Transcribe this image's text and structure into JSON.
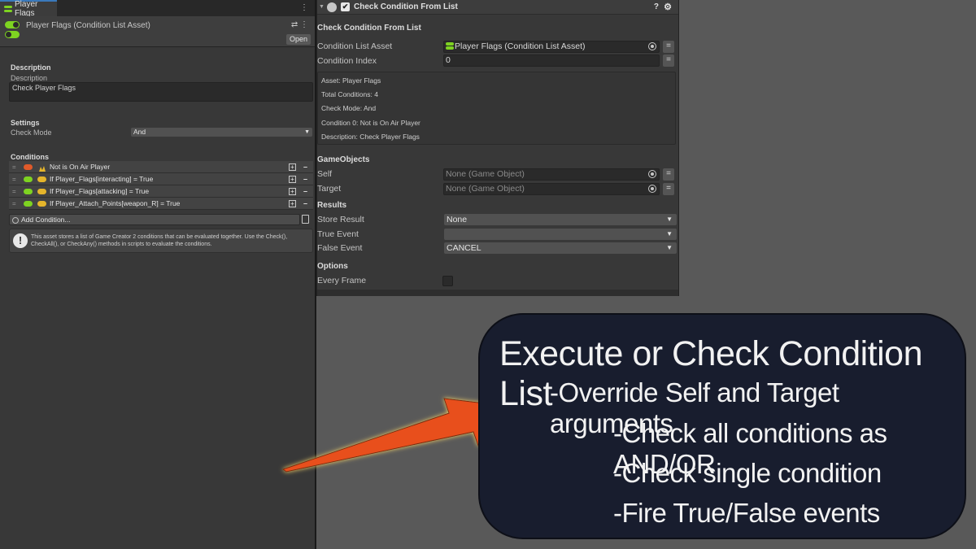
{
  "left_panel": {
    "tab_label": "Player Flags",
    "asset_title": "Player Flags (Condition List Asset)",
    "open_label": "Open",
    "description_header": "Description",
    "description_label": "Description",
    "description_value": "Check Player Flags",
    "settings_header": "Settings",
    "check_mode_label": "Check Mode",
    "check_mode_value": "And",
    "conditions_header": "Conditions",
    "conditions": [
      {
        "text": "Not is On Air Player"
      },
      {
        "text": "If Player_Flags[interacting] = True"
      },
      {
        "text": "If Player_Flags[attacking] = True"
      },
      {
        "text": "If Player_Attach_Points[weapon_R] = True"
      }
    ],
    "add_condition_label": "Add Condition...",
    "info_text": "This asset stores a list of Game Creator 2 conditions that can be evaluated together. Use the Check(), CheckAll(), or CheckAny() methods in scripts to evaluate the conditions."
  },
  "inspector": {
    "component_title": "Check Condition From List",
    "section_title": "Check Condition From List",
    "condition_list_asset_label": "Condition List Asset",
    "condition_list_asset_value": "Player Flags (Condition List Asset)",
    "condition_index_label": "Condition Index",
    "condition_index_value": "0",
    "summary": {
      "asset": "Asset: Player Flags",
      "total": "Total Conditions: 4",
      "mode": "Check Mode: And",
      "condition0": "Condition 0: Not is On Air Player",
      "description": "Description: Check Player Flags"
    },
    "gameobjects_header": "GameObjects",
    "self_label": "Self",
    "self_value": "None (Game Object)",
    "target_label": "Target",
    "target_value": "None (Game Object)",
    "results_header": "Results",
    "store_result_label": "Store Result",
    "store_result_value": "None",
    "true_event_label": "True Event",
    "true_event_value": "",
    "false_event_label": "False Event",
    "false_event_value": "CANCEL",
    "options_header": "Options",
    "every_frame_label": "Every Frame"
  },
  "callout": {
    "title": "Execute or Check Condition List",
    "bullets": [
      "-Override Self and Target arguments",
      "-Check all conditions as AND/OR",
      "-Check single condition",
      "-Fire True/False events"
    ]
  },
  "colors": {
    "arrow": "#e8501f",
    "callout_bg": "#181d2e",
    "toggle_green": "#7ed321",
    "toggle_red": "#e05a2a",
    "icon_yellow": "#e5b52b"
  }
}
